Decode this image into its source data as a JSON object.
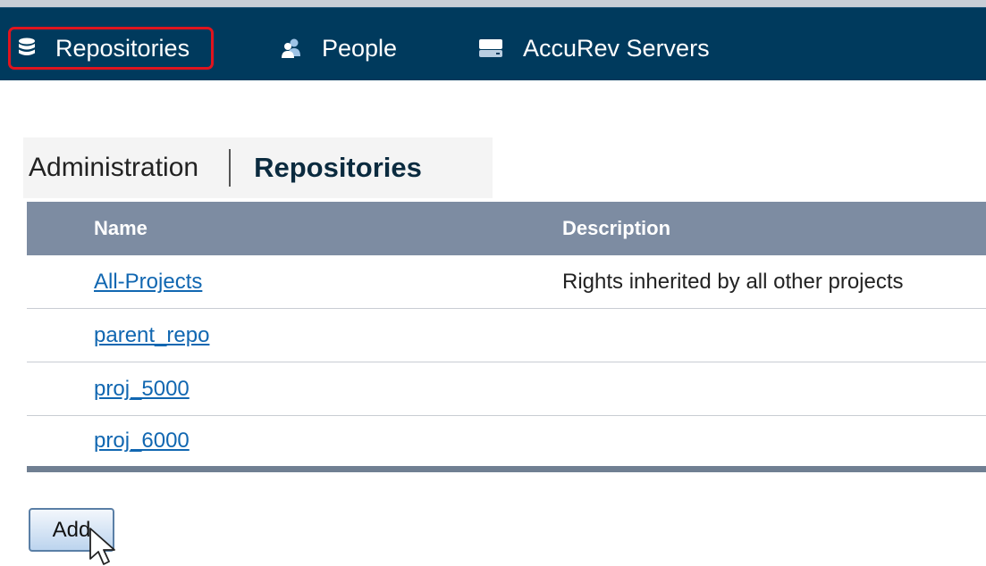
{
  "nav": {
    "items": [
      {
        "label": "Repositories",
        "icon": "database-icon",
        "active": true
      },
      {
        "label": "People",
        "icon": "people-icon",
        "active": false
      },
      {
        "label": "AccuRev Servers",
        "icon": "server-icon",
        "active": false
      }
    ]
  },
  "breadcrumb": {
    "parent": "Administration",
    "current": "Repositories"
  },
  "table": {
    "headers": [
      "Name",
      "Description"
    ],
    "rows": [
      {
        "name": "All-Projects",
        "description": "Rights inherited by all other projects"
      },
      {
        "name": "parent_repo",
        "description": ""
      },
      {
        "name": "proj_5000",
        "description": ""
      },
      {
        "name": "proj_6000",
        "description": ""
      }
    ]
  },
  "actions": {
    "add_label": "Add"
  },
  "colors": {
    "navbar": "#003a5d",
    "table_header": "#7d8ca2",
    "link": "#1167b1",
    "active_outline": "#e0141e"
  }
}
